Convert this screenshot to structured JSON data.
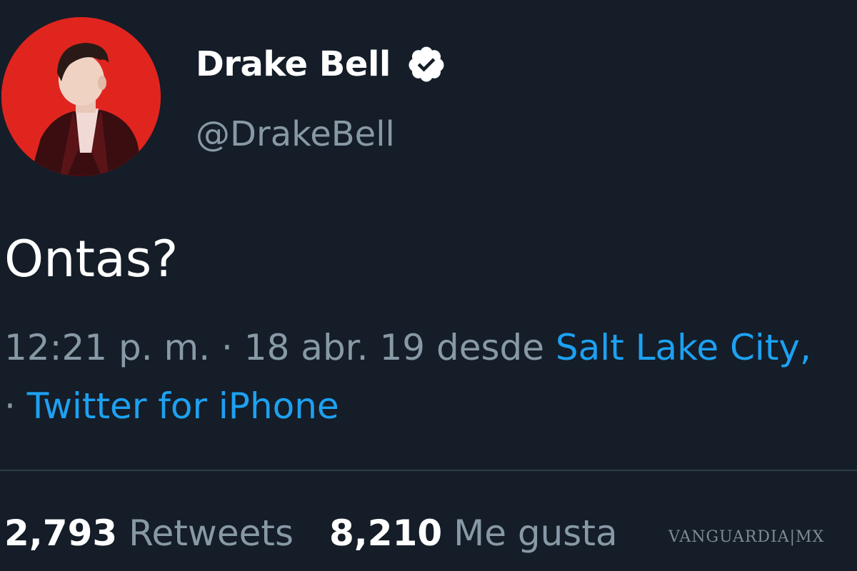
{
  "profile": {
    "display_name": "Drake Bell",
    "handle": "@DrakeBell",
    "verified_icon": "verified-badge-icon",
    "avatar_background": "#e0251f"
  },
  "tweet": {
    "text": "Ontas?",
    "time": "12:21 p. m. · 18 abr. 19 desde",
    "location": "Salt Lake City,",
    "separator": "· ",
    "source": "Twitter for iPhone"
  },
  "stats": {
    "retweets_count": "2,793",
    "retweets_label": "Retweets",
    "likes_count": "8,210",
    "likes_label": "Me gusta"
  },
  "watermark": "VANGUARDIA|MX",
  "colors": {
    "background": "#141d28",
    "secondary_text": "#8899a6",
    "link": "#1da1f2",
    "divider": "#2f3b47"
  }
}
